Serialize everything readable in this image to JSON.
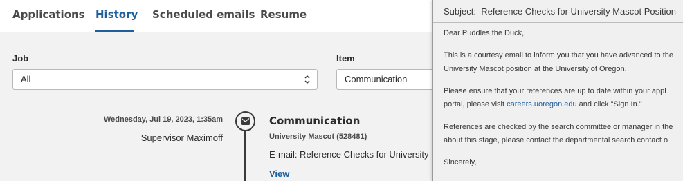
{
  "tabs": [
    {
      "label": "Applications",
      "active": false
    },
    {
      "label": "History",
      "active": true
    },
    {
      "label": "Scheduled emails",
      "active": false
    },
    {
      "label": "Resume",
      "active": false
    }
  ],
  "filters": {
    "job": {
      "label": "Job",
      "value": "All"
    },
    "item": {
      "label": "Item",
      "value": "Communication"
    }
  },
  "timeline": {
    "date": "Wednesday, Jul 19, 2023, 1:35am",
    "person": "Supervisor Maximoff",
    "icon": "envelope-icon",
    "title": "Communication",
    "subtitle": "University Mascot (528481)",
    "email_line": "E-mail: Reference Checks for University M",
    "view_label": "View"
  },
  "email": {
    "subject_label": "Subject:",
    "subject": "Reference Checks for University Mascot Position",
    "greeting": "Dear Puddles the Duck,",
    "p1_l1": "This is a courtesy email to inform you that you have advanced to the",
    "p1_l2": "University Mascot position at the University of Oregon.",
    "p2_l1": "Please ensure that your references are up to date within your appl",
    "p2_l2_pre": "portal, please visit ",
    "p2_link": "careers.uoregon.edu",
    "p2_l2_post": " and click \"Sign In.\"",
    "p3_l1": "References are checked by the search committee or manager in the",
    "p3_l2": "about this stage, please contact the departmental search contact o",
    "closing": "Sincerely,"
  },
  "colors": {
    "accent": "#1f5f9a",
    "background": "#f2f2f2",
    "panel": "#f0f0f0"
  }
}
